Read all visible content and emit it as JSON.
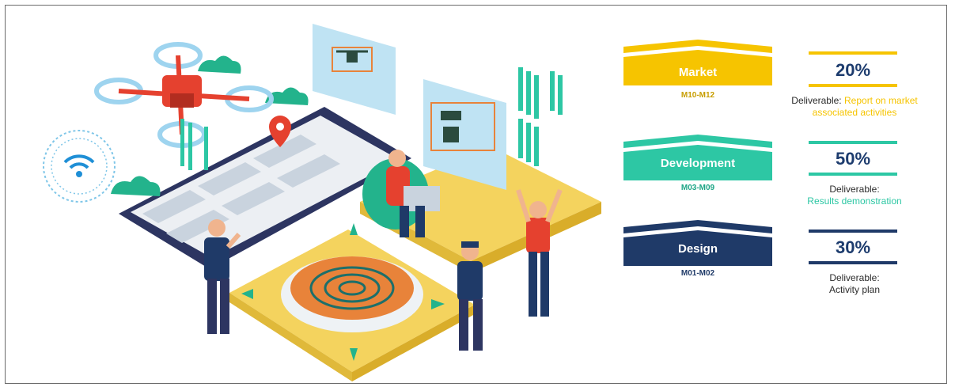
{
  "colors": {
    "market": "#f6c400",
    "development": "#2dc7a4",
    "design": "#1f3a68",
    "text": "#2b2b2b",
    "percent_text": "#1d3c6e"
  },
  "phases": [
    {
      "name": "Market",
      "months": "M10-M12",
      "percent": "20%",
      "deliverable_prefix": "Deliverable:",
      "deliverable": "Report on market associated activities"
    },
    {
      "name": "Development",
      "months": "M03-M09",
      "percent": "50%",
      "deliverable_prefix": "Deliverable:",
      "deliverable": "Results demonstration"
    },
    {
      "name": "Design",
      "months": "M01-M02",
      "percent": "30%",
      "deliverable_prefix": "Deliverable:",
      "deliverable": "Activity plan"
    }
  ]
}
